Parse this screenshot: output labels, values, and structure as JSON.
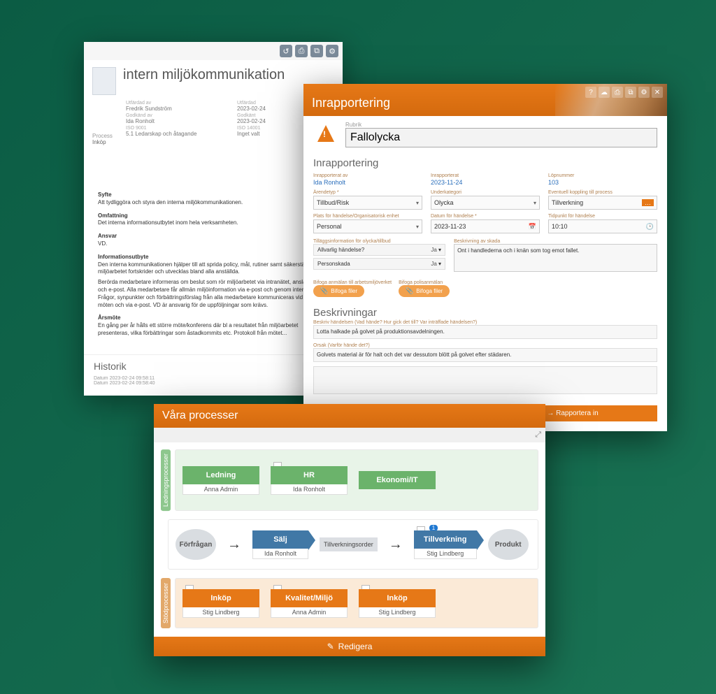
{
  "doc": {
    "title": "intern miljökommunikation",
    "toolbar_icons": [
      "hist-icon",
      "print-icon",
      "copy-icon",
      "gear-icon"
    ],
    "meta": {
      "utfardad_av_label": "Utfärdad av",
      "utfardad_av": "Fredrik Sundström",
      "utfardad_label": "Utfärdad",
      "utfardad": "2023-02-24",
      "godkand_av_label": "Godkänd av",
      "godkand_av": "Ida Ronholt",
      "godkant_label": "Godkänt",
      "godkant": "2023-02-24",
      "iso9001_label": "ISO 9001",
      "iso9001": "5.1 Ledarskap och åtagande",
      "iso14001_label": "ISO 14001",
      "iso14001": "Inget valt",
      "process_label": "Process",
      "process": "Inköp"
    },
    "body": {
      "syfte_h": "Syfte",
      "syfte_p": "Att tydliggöra och styra den interna miljökommunikationen.",
      "omfattning_h": "Omfattning",
      "omfattning_p": "Det interna informationsutbytet inom hela verksamheten.",
      "ansvar_h": "Ansvar",
      "ansvar_p": "VD.",
      "info_h": "Informationsutbyte",
      "info_p1": "Den interna kommunikationen hjälper till att sprida policy, mål, rutiner samt säkerställa att miljöarbetet fortskrider och utvecklas bland alla anställda.",
      "info_p2": "Berörda medarbetare informeras om beslut som rör miljöarbetet via intranätet, anslagstavlor och e-post. Alla medarbetare får allmän miljöinformation via e-post och genom interna möten. Frågor, synpunkter och förbättringsförslag från alla medarbetare kommuniceras vid dessa möten och via e-post. VD är ansvarig för de uppföljningar som krävs.",
      "arsmote_h": "Årsmöte",
      "arsmote_p": "En gång per år hålls ett större möte/konferens där bl a resultatet från miljöarbetet presenteras, vilka förbättringar som åstadkommits etc. Protokoll från mötet..."
    },
    "history": {
      "title": "Historik",
      "row1_label": "Datum",
      "row1": "2023-02-24 09:58:11",
      "row2_label": "Datum",
      "row2": "2023-02-24 09:58:40"
    }
  },
  "report": {
    "header_title": "Inrapportering",
    "rubrik_label": "Rubrik",
    "rubrik_value": "Fallolycka",
    "section_inrapp": "Inrapportering",
    "fields": {
      "inrapp_av_label": "Inrapporterat av",
      "inrapp_av": "Ida Ronholt",
      "inrapp_label": "Inrapporterat",
      "inrapp": "2023-11-24",
      "lopnr_label": "Löpnummer",
      "lopnr": "103",
      "arendetyp_label": "Ärendetyp",
      "arendetyp": "Tillbud/Risk",
      "underkat_label": "Underkategori",
      "underkat": "Olycka",
      "koppling_label": "Eventuell koppling till process",
      "koppling": "Tillverkning",
      "plats_label": "Plats för händelse/Organisatorisk enhet",
      "plats": "Personal",
      "datum_label": "Datum för händelse",
      "datum": "2023-11-23",
      "tid_label": "Tidpunkt för händelse",
      "tid": "10:10"
    },
    "extra": {
      "tillagg_label": "Tilläggsinformation för olycka/tillbud",
      "allvarlig_label": "Allvarlig händelse?",
      "allvarlig": "Ja",
      "personskada_label": "Personskada",
      "personskada": "Ja",
      "skada_label": "Beskrivning av skada",
      "skada": "Ont i handlederna och i knän som tog emot fallet."
    },
    "attach": {
      "a1_label": "Bifoga anmälan till arbetsmiljöverket",
      "a2_label": "Bifoga polisanmälan",
      "btn": "Bifoga filer"
    },
    "desc": {
      "section": "Beskrivningar",
      "hand_label": "Beskriv händelsen (Vad hände? Hur gick det till? Var inträffade händelsen?)",
      "hand": "Lotta halkade på golvet på produktionsavdelningen.",
      "orsak_label": "Orsak (Varför hände det?)",
      "orsak": "Golvets material är för halt och det var dessutom blött på golvet efter städaren."
    },
    "footer": {
      "btn1": "",
      "btn2": "Rapportera in"
    }
  },
  "proc": {
    "title": "Våra processer",
    "lane1_label": "Ledningsprocesser",
    "lane3_label": "Stödprocesser",
    "green_boxes": [
      {
        "name": "Ledning",
        "owner": "Anna Admin"
      },
      {
        "name": "HR",
        "owner": "Ida Ronholt"
      },
      {
        "name": "Ekonomi/IT",
        "owner": ""
      }
    ],
    "flow": {
      "start": "Förfrågan",
      "salj": "Sälj",
      "salj_owner": "Ida Ronholt",
      "order": "Tillverkningsorder",
      "tillv": "Tillverkning",
      "tillv_owner": "Stig Lindberg",
      "tillv_badge": "1",
      "end": "Produkt"
    },
    "orange_boxes": [
      {
        "name": "Inköp",
        "owner": "Stig Lindberg"
      },
      {
        "name": "Kvalitet/Miljö",
        "owner": "Anna Admin"
      },
      {
        "name": "Inköp",
        "owner": "Stig Lindberg"
      }
    ],
    "footer": "Redigera"
  }
}
